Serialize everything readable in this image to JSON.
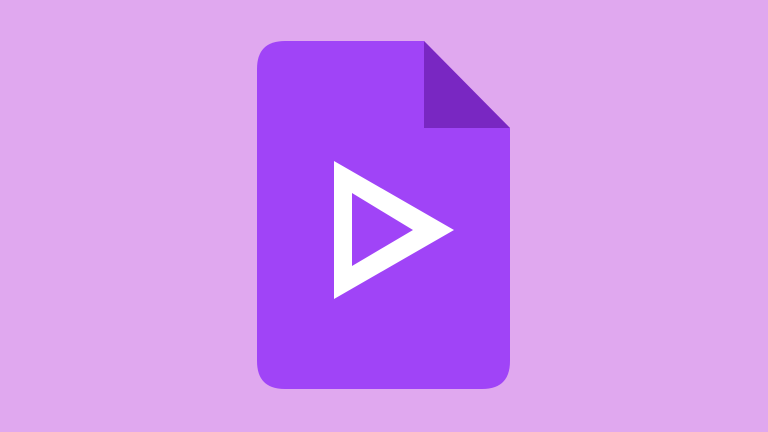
{
  "icon": "video-file-icon",
  "colors": {
    "background": "#E0A8EF",
    "file_body": "#A044F7",
    "folded_corner": "#7927C2",
    "play_glyph": "#FFFFFF"
  }
}
